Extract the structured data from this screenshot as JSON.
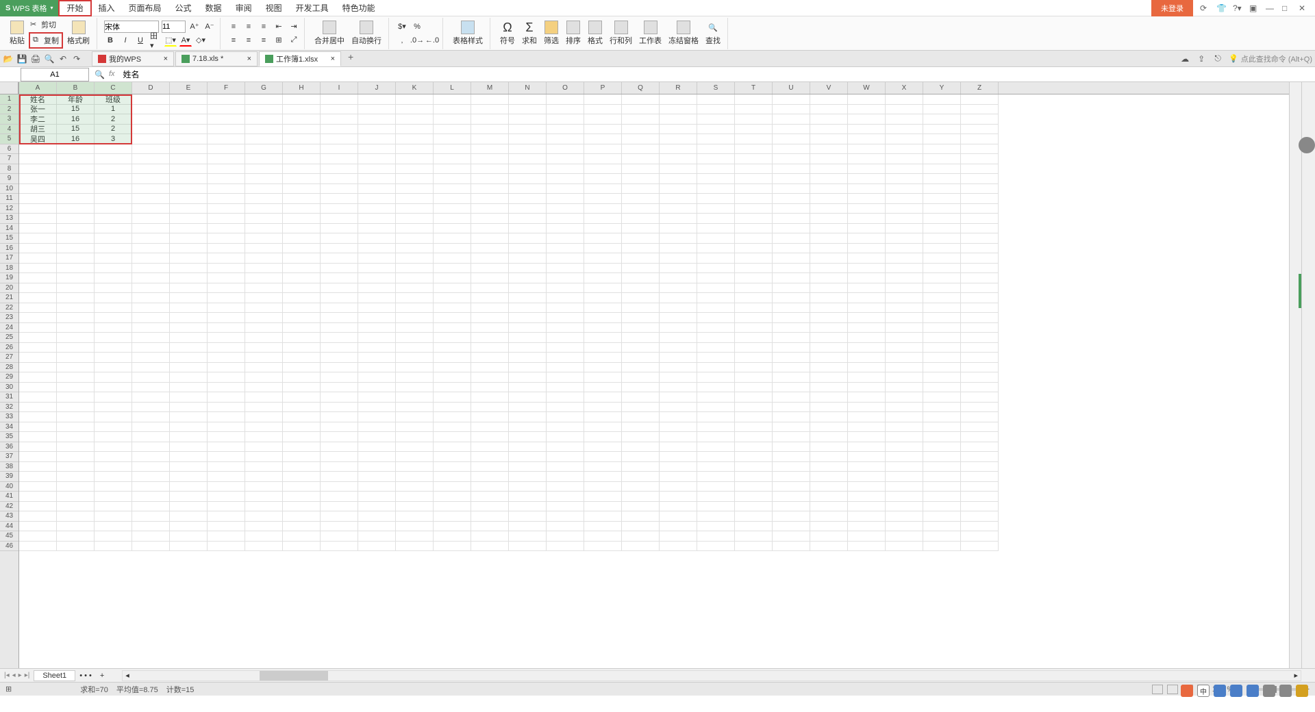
{
  "app": {
    "name": "WPS 表格"
  },
  "menu": {
    "tabs": [
      "开始",
      "插入",
      "页面布局",
      "公式",
      "数据",
      "审阅",
      "视图",
      "开发工具",
      "特色功能"
    ],
    "active_index": 0
  },
  "title_right": {
    "login": "未登录"
  },
  "ribbon": {
    "paste": "粘贴",
    "cut": "剪切",
    "copy": "复制",
    "format_painter": "格式刷",
    "font_name": "宋体",
    "font_size": "11",
    "merge_center": "合并居中",
    "auto_wrap": "自动换行",
    "table_style": "表格样式",
    "symbol": "符号",
    "sum": "求和",
    "filter": "筛选",
    "sort": "排序",
    "format": "格式",
    "row_col": "行和列",
    "worksheet": "工作表",
    "freeze": "冻结窗格",
    "find": "查找"
  },
  "qa": {
    "search_hint": "点此查找命令 (Alt+Q)"
  },
  "doc_tabs": [
    {
      "label": "我的WPS",
      "icon": "wps"
    },
    {
      "label": "7.18.xls *",
      "icon": "sheet"
    },
    {
      "label": "工作簿1.xlsx",
      "icon": "sheet",
      "active": true
    }
  ],
  "formula": {
    "cell_ref": "A1",
    "value": "姓名"
  },
  "columns": [
    "A",
    "B",
    "C",
    "D",
    "E",
    "F",
    "G",
    "H",
    "I",
    "J",
    "K",
    "L",
    "M",
    "N",
    "O",
    "P",
    "Q",
    "R",
    "S",
    "T",
    "U",
    "V",
    "W",
    "X",
    "Y",
    "Z"
  ],
  "sheet_data": [
    [
      "姓名",
      "年龄",
      "班级"
    ],
    [
      "张一",
      "15",
      "1"
    ],
    [
      "李二",
      "16",
      "2"
    ],
    [
      "胡三",
      "15",
      "2"
    ],
    [
      "吴四",
      "16",
      "3"
    ]
  ],
  "row_count": 46,
  "sheets": {
    "tabs": [
      "Sheet1"
    ],
    "extra": "• • •"
  },
  "status": {
    "sum": "求和=70",
    "avg": "平均值=8.75",
    "count": "计数=15",
    "zoom": "100 %"
  }
}
